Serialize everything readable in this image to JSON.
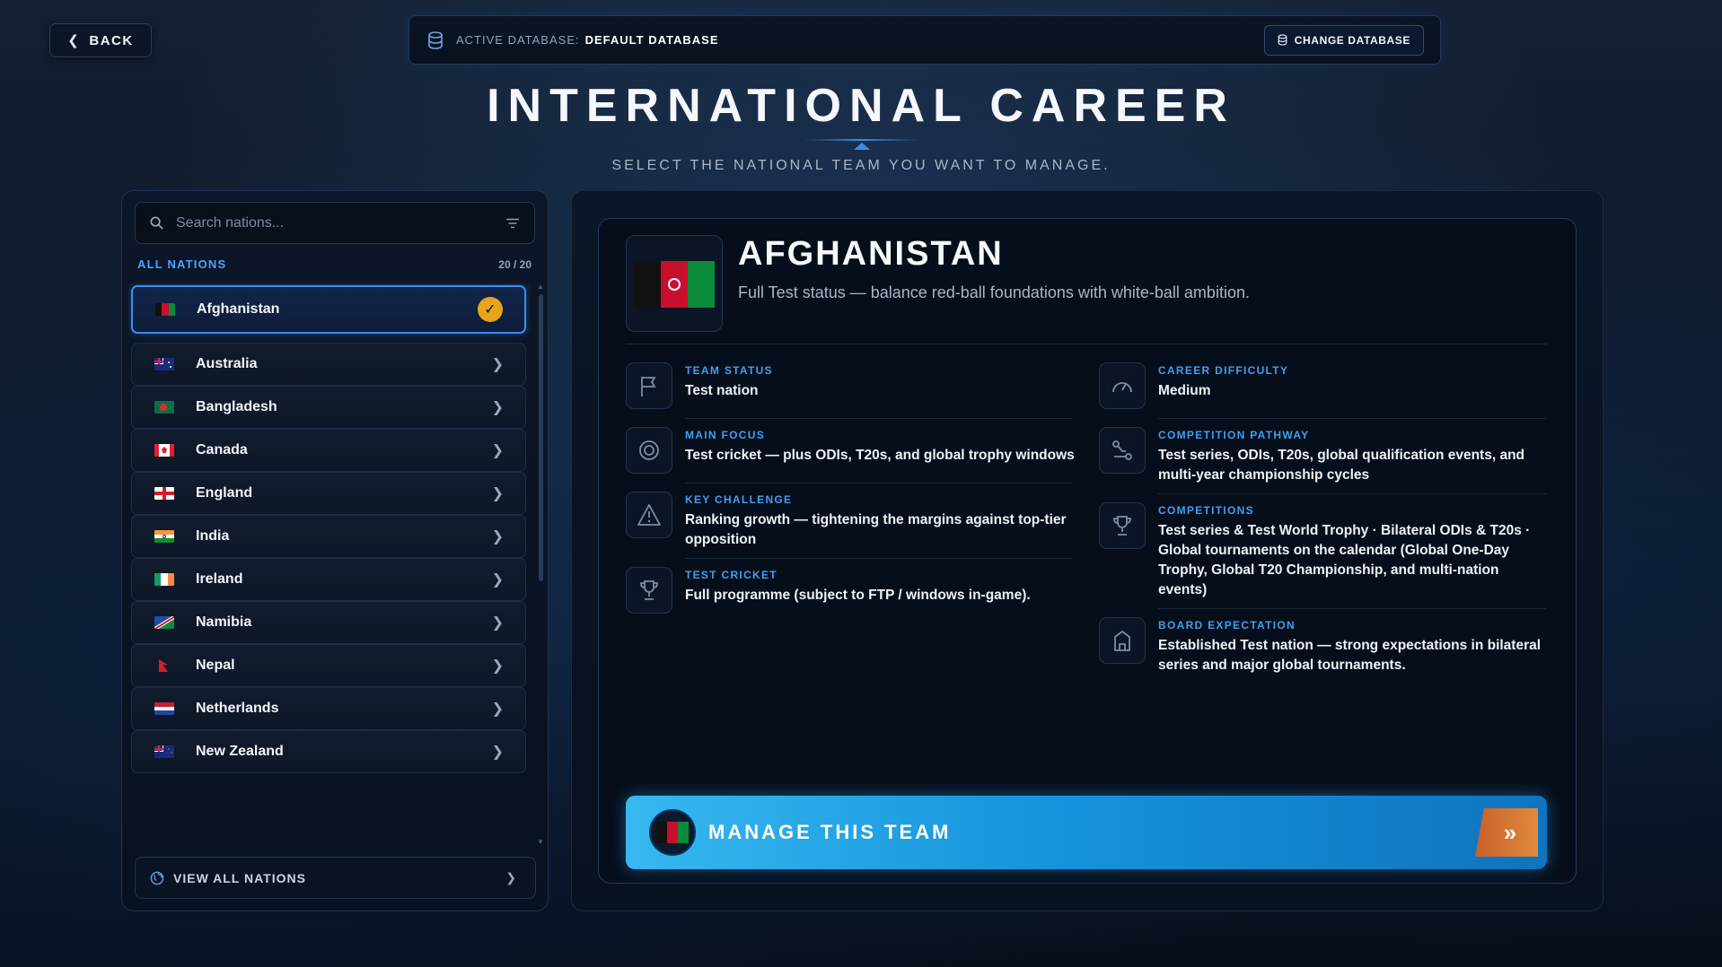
{
  "header": {
    "back_label": "BACK",
    "db_label": "ACTIVE DATABASE:",
    "db_value": "DEFAULT DATABASE",
    "change_db_label": "CHANGE DATABASE"
  },
  "title": "INTERNATIONAL CAREER",
  "subtitle": "SELECT THE NATIONAL TEAM YOU WANT TO MANAGE.",
  "sidebar": {
    "search_placeholder": "Search nations...",
    "section_label": "ALL NATIONS",
    "count": "20 / 20",
    "nations": [
      {
        "name": "Afghanistan",
        "selected": true
      },
      {
        "name": "Australia"
      },
      {
        "name": "Bangladesh"
      },
      {
        "name": "Canada"
      },
      {
        "name": "England"
      },
      {
        "name": "India"
      },
      {
        "name": "Ireland"
      },
      {
        "name": "Namibia"
      },
      {
        "name": "Nepal"
      },
      {
        "name": "Netherlands"
      },
      {
        "name": "New Zealand"
      }
    ],
    "view_all_label": "VIEW ALL NATIONS"
  },
  "detail": {
    "country": "AFGHANISTAN",
    "description": "Full Test status — balance red-ball foundations with white-ball ambition.",
    "left_items": [
      {
        "icon": "flag-icon",
        "label": "TEAM STATUS",
        "value": "Test nation"
      },
      {
        "icon": "target-icon",
        "label": "MAIN FOCUS",
        "value": "Test cricket — plus ODIs, T20s, and global trophy windows"
      },
      {
        "icon": "warning-icon",
        "label": "KEY CHALLENGE",
        "value": "Ranking growth — tightening the margins against top-tier opposition"
      },
      {
        "icon": "trophy-icon",
        "label": "TEST CRICKET",
        "value": "Full programme (subject to FTP / windows in-game)."
      }
    ],
    "right_items": [
      {
        "icon": "gauge-icon",
        "label": "CAREER DIFFICULTY",
        "value": "Medium"
      },
      {
        "icon": "pathway-icon",
        "label": "COMPETITION PATHWAY",
        "value": "Test series, ODIs, T20s, global qualification events, and multi-year championship cycles"
      },
      {
        "icon": "trophy-icon",
        "label": "COMPETITIONS",
        "value": "Test series & Test World Trophy · Bilateral ODIs & T20s · Global tournaments on the calendar (Global One-Day Trophy, Global T20 Championship, and multi-nation events)"
      },
      {
        "icon": "building-icon",
        "label": "BOARD EXPECTATION",
        "value": "Established Test nation — strong expectations in bilateral series and major global tournaments."
      }
    ],
    "manage_label": "MANAGE THIS TEAM"
  },
  "colors": {
    "accent": "#3d8cf0",
    "label_blue": "#3fa0f0",
    "check_gold": "#e8a31c",
    "manage_blue": "#1594dc",
    "arrow_orange": "#d9773a"
  }
}
